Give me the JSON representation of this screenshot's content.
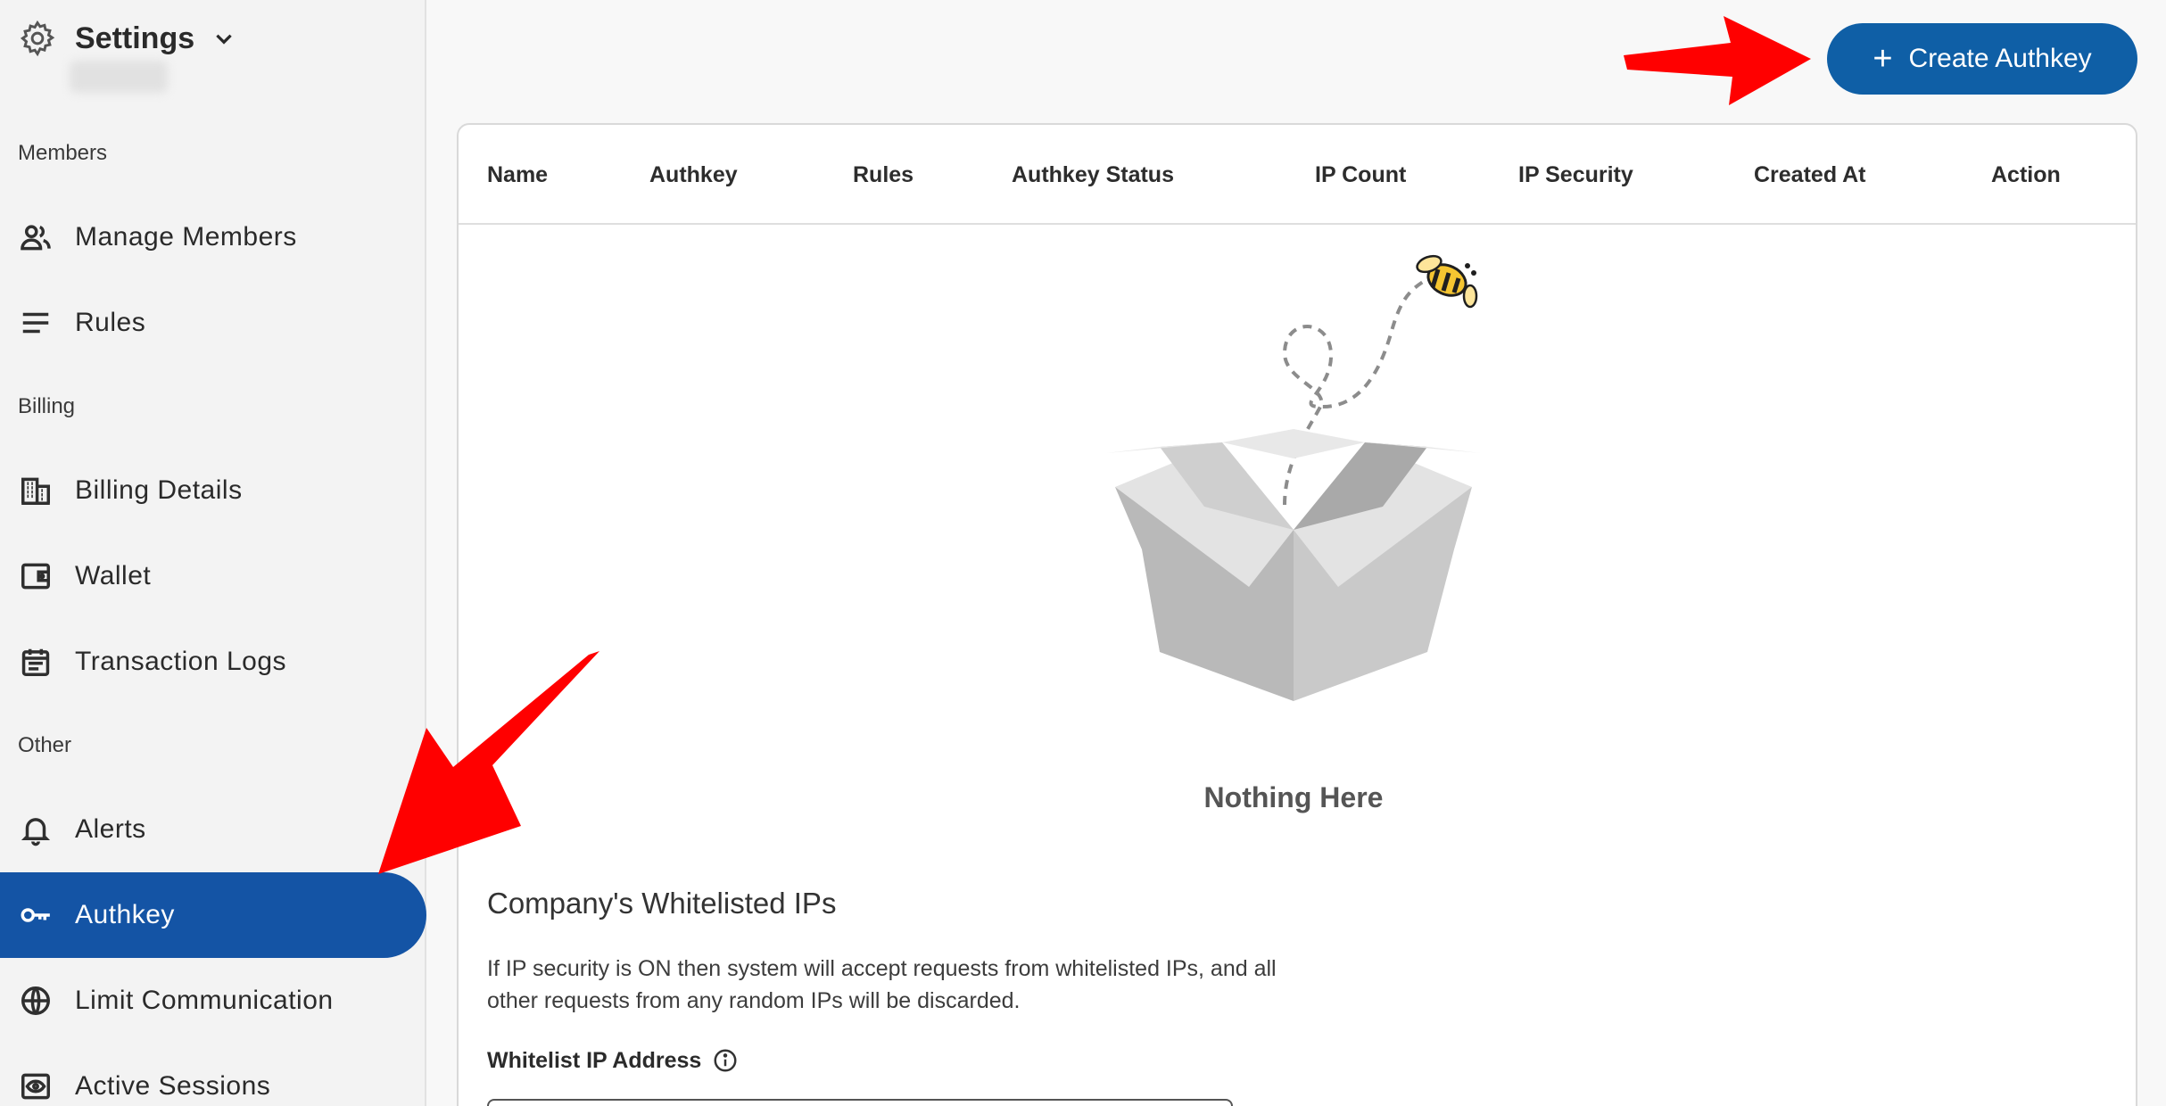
{
  "sidebar": {
    "title": "Settings",
    "sections": {
      "members": "Members",
      "billing": "Billing",
      "other": "Other"
    },
    "items": [
      {
        "label": "Manage Members",
        "icon": "people-icon"
      },
      {
        "label": "Rules",
        "icon": "lines-icon"
      },
      {
        "label": "Billing Details",
        "icon": "building-icon"
      },
      {
        "label": "Wallet",
        "icon": "wallet-icon"
      },
      {
        "label": "Transaction Logs",
        "icon": "calendar-icon"
      },
      {
        "label": "Alerts",
        "icon": "bell-icon"
      },
      {
        "label": "Authkey",
        "icon": "key-icon",
        "active": true
      },
      {
        "label": "Limit Communication",
        "icon": "globe-icon"
      },
      {
        "label": "Active Sessions",
        "icon": "eye-icon"
      }
    ]
  },
  "header": {
    "create_label": "Create Authkey"
  },
  "table": {
    "columns": [
      "Name",
      "Authkey",
      "Rules",
      "Authkey Status",
      "IP Count",
      "IP Security",
      "Created At",
      "Action"
    ],
    "empty_text": "Nothing Here"
  },
  "whitelist": {
    "title": "Company's Whitelisted IPs",
    "description": "If IP security is ON then system will accept requests from whitelisted IPs, and all other requests from any random IPs will be discarded.",
    "field_label": "Whitelist IP Address"
  },
  "colors": {
    "accent": "#1454a5",
    "button": "#0f5fa6",
    "annotation": "#ff0000"
  }
}
